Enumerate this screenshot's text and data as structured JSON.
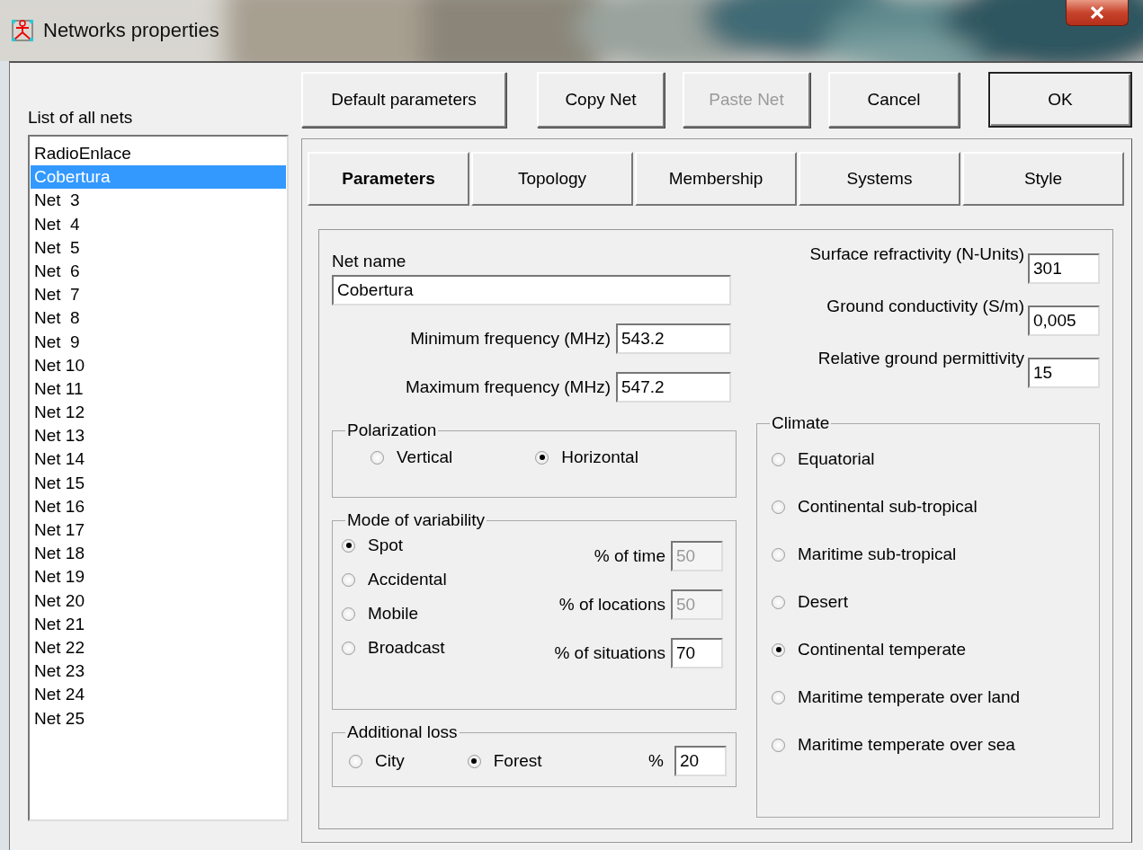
{
  "window": {
    "title": "Networks properties"
  },
  "nets": {
    "label": "List of all nets",
    "items": [
      {
        "name": "RadioEnlace",
        "selected": false
      },
      {
        "name": "Cobertura",
        "selected": true
      },
      {
        "name": "Net  3",
        "selected": false
      },
      {
        "name": "Net  4",
        "selected": false
      },
      {
        "name": "Net  5",
        "selected": false
      },
      {
        "name": "Net  6",
        "selected": false
      },
      {
        "name": "Net  7",
        "selected": false
      },
      {
        "name": "Net  8",
        "selected": false
      },
      {
        "name": "Net  9",
        "selected": false
      },
      {
        "name": "Net 10",
        "selected": false
      },
      {
        "name": "Net 11",
        "selected": false
      },
      {
        "name": "Net 12",
        "selected": false
      },
      {
        "name": "Net 13",
        "selected": false
      },
      {
        "name": "Net 14",
        "selected": false
      },
      {
        "name": "Net 15",
        "selected": false
      },
      {
        "name": "Net 16",
        "selected": false
      },
      {
        "name": "Net 17",
        "selected": false
      },
      {
        "name": "Net 18",
        "selected": false
      },
      {
        "name": "Net 19",
        "selected": false
      },
      {
        "name": "Net 20",
        "selected": false
      },
      {
        "name": "Net 21",
        "selected": false
      },
      {
        "name": "Net 22",
        "selected": false
      },
      {
        "name": "Net 23",
        "selected": false
      },
      {
        "name": "Net 24",
        "selected": false
      },
      {
        "name": "Net 25",
        "selected": false
      }
    ]
  },
  "buttons": [
    {
      "label": "Default parameters",
      "disabled": false,
      "default": false
    },
    {
      "label": "Copy Net",
      "disabled": false,
      "default": false
    },
    {
      "label": "Paste Net",
      "disabled": true,
      "default": false
    },
    {
      "label": "Cancel",
      "disabled": false,
      "default": false
    },
    {
      "label": "OK",
      "disabled": false,
      "default": true
    }
  ],
  "tabs": [
    {
      "label": "Parameters",
      "selected": true
    },
    {
      "label": "Topology",
      "selected": false
    },
    {
      "label": "Membership",
      "selected": false
    },
    {
      "label": "Systems",
      "selected": false
    },
    {
      "label": "Style",
      "selected": false
    }
  ],
  "net_name": {
    "label": "Net name",
    "value": "Cobertura"
  },
  "frequencies": [
    {
      "label": "Minimum frequency (MHz)",
      "value": "543.2"
    },
    {
      "label": "Maximum frequency (MHz)",
      "value": "547.2"
    }
  ],
  "ground": [
    {
      "label": "Surface refractivity (N-Units)",
      "value": "301"
    },
    {
      "label": "Ground conductivity (S/m)",
      "value": "0,005"
    },
    {
      "label": "Relative ground permittivity",
      "value": "15"
    }
  ],
  "polarization": {
    "title": "Polarization",
    "options": [
      {
        "label": "Vertical",
        "selected": false
      },
      {
        "label": "Horizontal",
        "selected": true
      }
    ]
  },
  "variability": {
    "title": "Mode of variability",
    "options": [
      {
        "label": "Spot",
        "selected": true
      },
      {
        "label": "Accidental",
        "selected": false
      },
      {
        "label": "Mobile",
        "selected": false
      },
      {
        "label": "Broadcast",
        "selected": false
      }
    ],
    "fields": [
      {
        "label": "% of time",
        "value": "50",
        "disabled": true
      },
      {
        "label": "% of locations",
        "value": "50",
        "disabled": true
      },
      {
        "label": "% of situations",
        "value": "70",
        "disabled": false
      }
    ]
  },
  "additional_loss": {
    "title": "Additional loss",
    "options": [
      {
        "label": "City",
        "selected": false
      },
      {
        "label": "Forest",
        "selected": true
      }
    ],
    "percent": {
      "label": "%",
      "value": "20"
    }
  },
  "climate": {
    "title": "Climate",
    "options": [
      {
        "label": "Equatorial",
        "selected": false
      },
      {
        "label": "Continental sub-tropical",
        "selected": false
      },
      {
        "label": "Maritime sub-tropical",
        "selected": false
      },
      {
        "label": "Desert",
        "selected": false
      },
      {
        "label": "Continental temperate",
        "selected": true
      },
      {
        "label": "Maritime temperate over land",
        "selected": false
      },
      {
        "label": "Maritime temperate over sea",
        "selected": false
      }
    ]
  }
}
